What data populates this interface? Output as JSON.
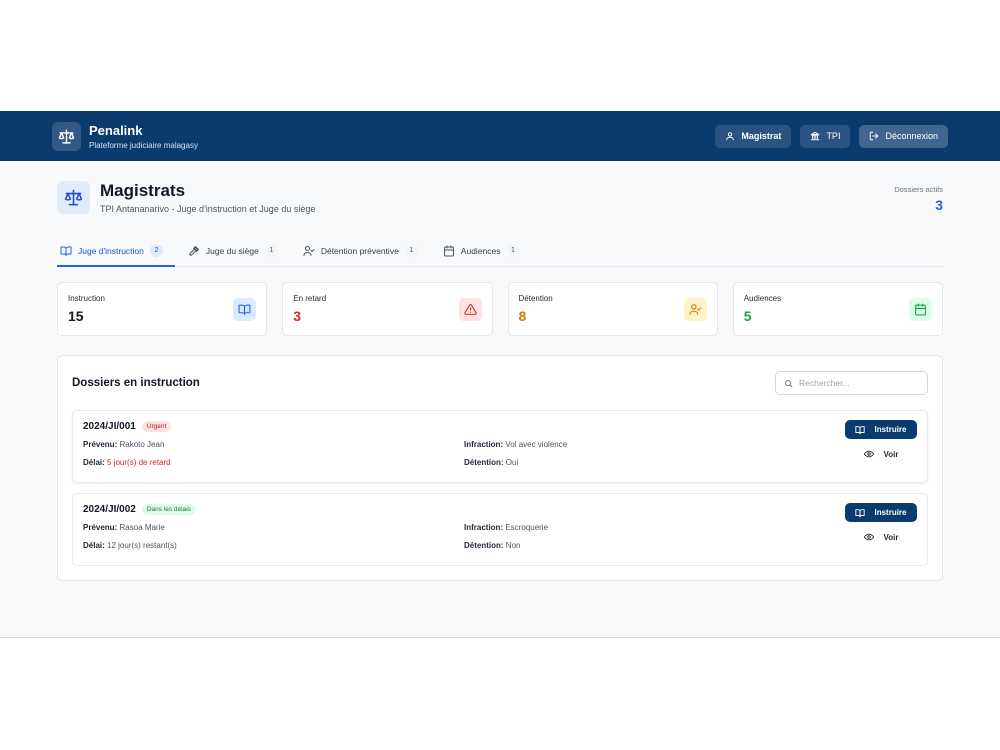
{
  "header": {
    "app_name": "Penalink",
    "app_subtitle": "Plateforme judiciaire malagasy",
    "buttons": [
      {
        "label": "Magistrat",
        "icon": "user-icon"
      },
      {
        "label": "TPI",
        "icon": "building-icon"
      },
      {
        "label": "Déconnexion",
        "icon": "logout-icon"
      }
    ]
  },
  "page": {
    "title": "Magistrats",
    "subtitle": "TPI Antananarivo - Juge d'instruction et Juge du siège",
    "active_label": "Dossiers actifs",
    "active_value": "3"
  },
  "tabs": [
    {
      "label": "Juge d'instruction",
      "count": "2",
      "icon": "book-icon",
      "active": true
    },
    {
      "label": "Juge du siège",
      "count": "1",
      "icon": "gavel-icon"
    },
    {
      "label": "Détention préventive",
      "count": "1",
      "icon": "user-check-icon"
    },
    {
      "label": "Audiences",
      "count": "1",
      "icon": "calendar-icon"
    }
  ],
  "stats": [
    {
      "label": "Instruction",
      "value": "15",
      "color": "#111827",
      "icon": "book-icon",
      "icon_bg": "#dbeafe",
      "icon_color": "#2563eb"
    },
    {
      "label": "En retard",
      "value": "3",
      "color": "#dc2626",
      "icon": "alert-triangle-icon",
      "icon_bg": "#fde2e2",
      "icon_color": "#dc2626"
    },
    {
      "label": "Détention",
      "value": "8",
      "color": "#d97706",
      "icon": "user-check-icon",
      "icon_bg": "#fef3c7",
      "icon_color": "#d97706"
    },
    {
      "label": "Audiences",
      "value": "5",
      "color": "#16a34a",
      "icon": "calendar-icon",
      "icon_bg": "#dcfce7",
      "icon_color": "#16a34a"
    }
  ],
  "panel": {
    "title": "Dossiers en instruction",
    "search_placeholder": "Rechercher..."
  },
  "labels": {
    "prevenu": "Prévenu:",
    "infraction": "Infraction:",
    "delai": "Délai:",
    "detention": "Détention:",
    "instruire": "Instruire",
    "voir": "Voir"
  },
  "cases": [
    {
      "id": "2024/JI/001",
      "badge": "Urgent",
      "prevenu": "Rakoto Jean",
      "infraction": "Vol avec violence",
      "delai": "5 jour(s) de retard",
      "detention": "Oui"
    },
    {
      "id": "2024/JI/002",
      "badge": "Dans les délais",
      "prevenu": "Rasoa Marie",
      "infraction": "Escroquerie",
      "delai": "12 jour(s) restant(s)",
      "detention": "Non"
    }
  ]
}
